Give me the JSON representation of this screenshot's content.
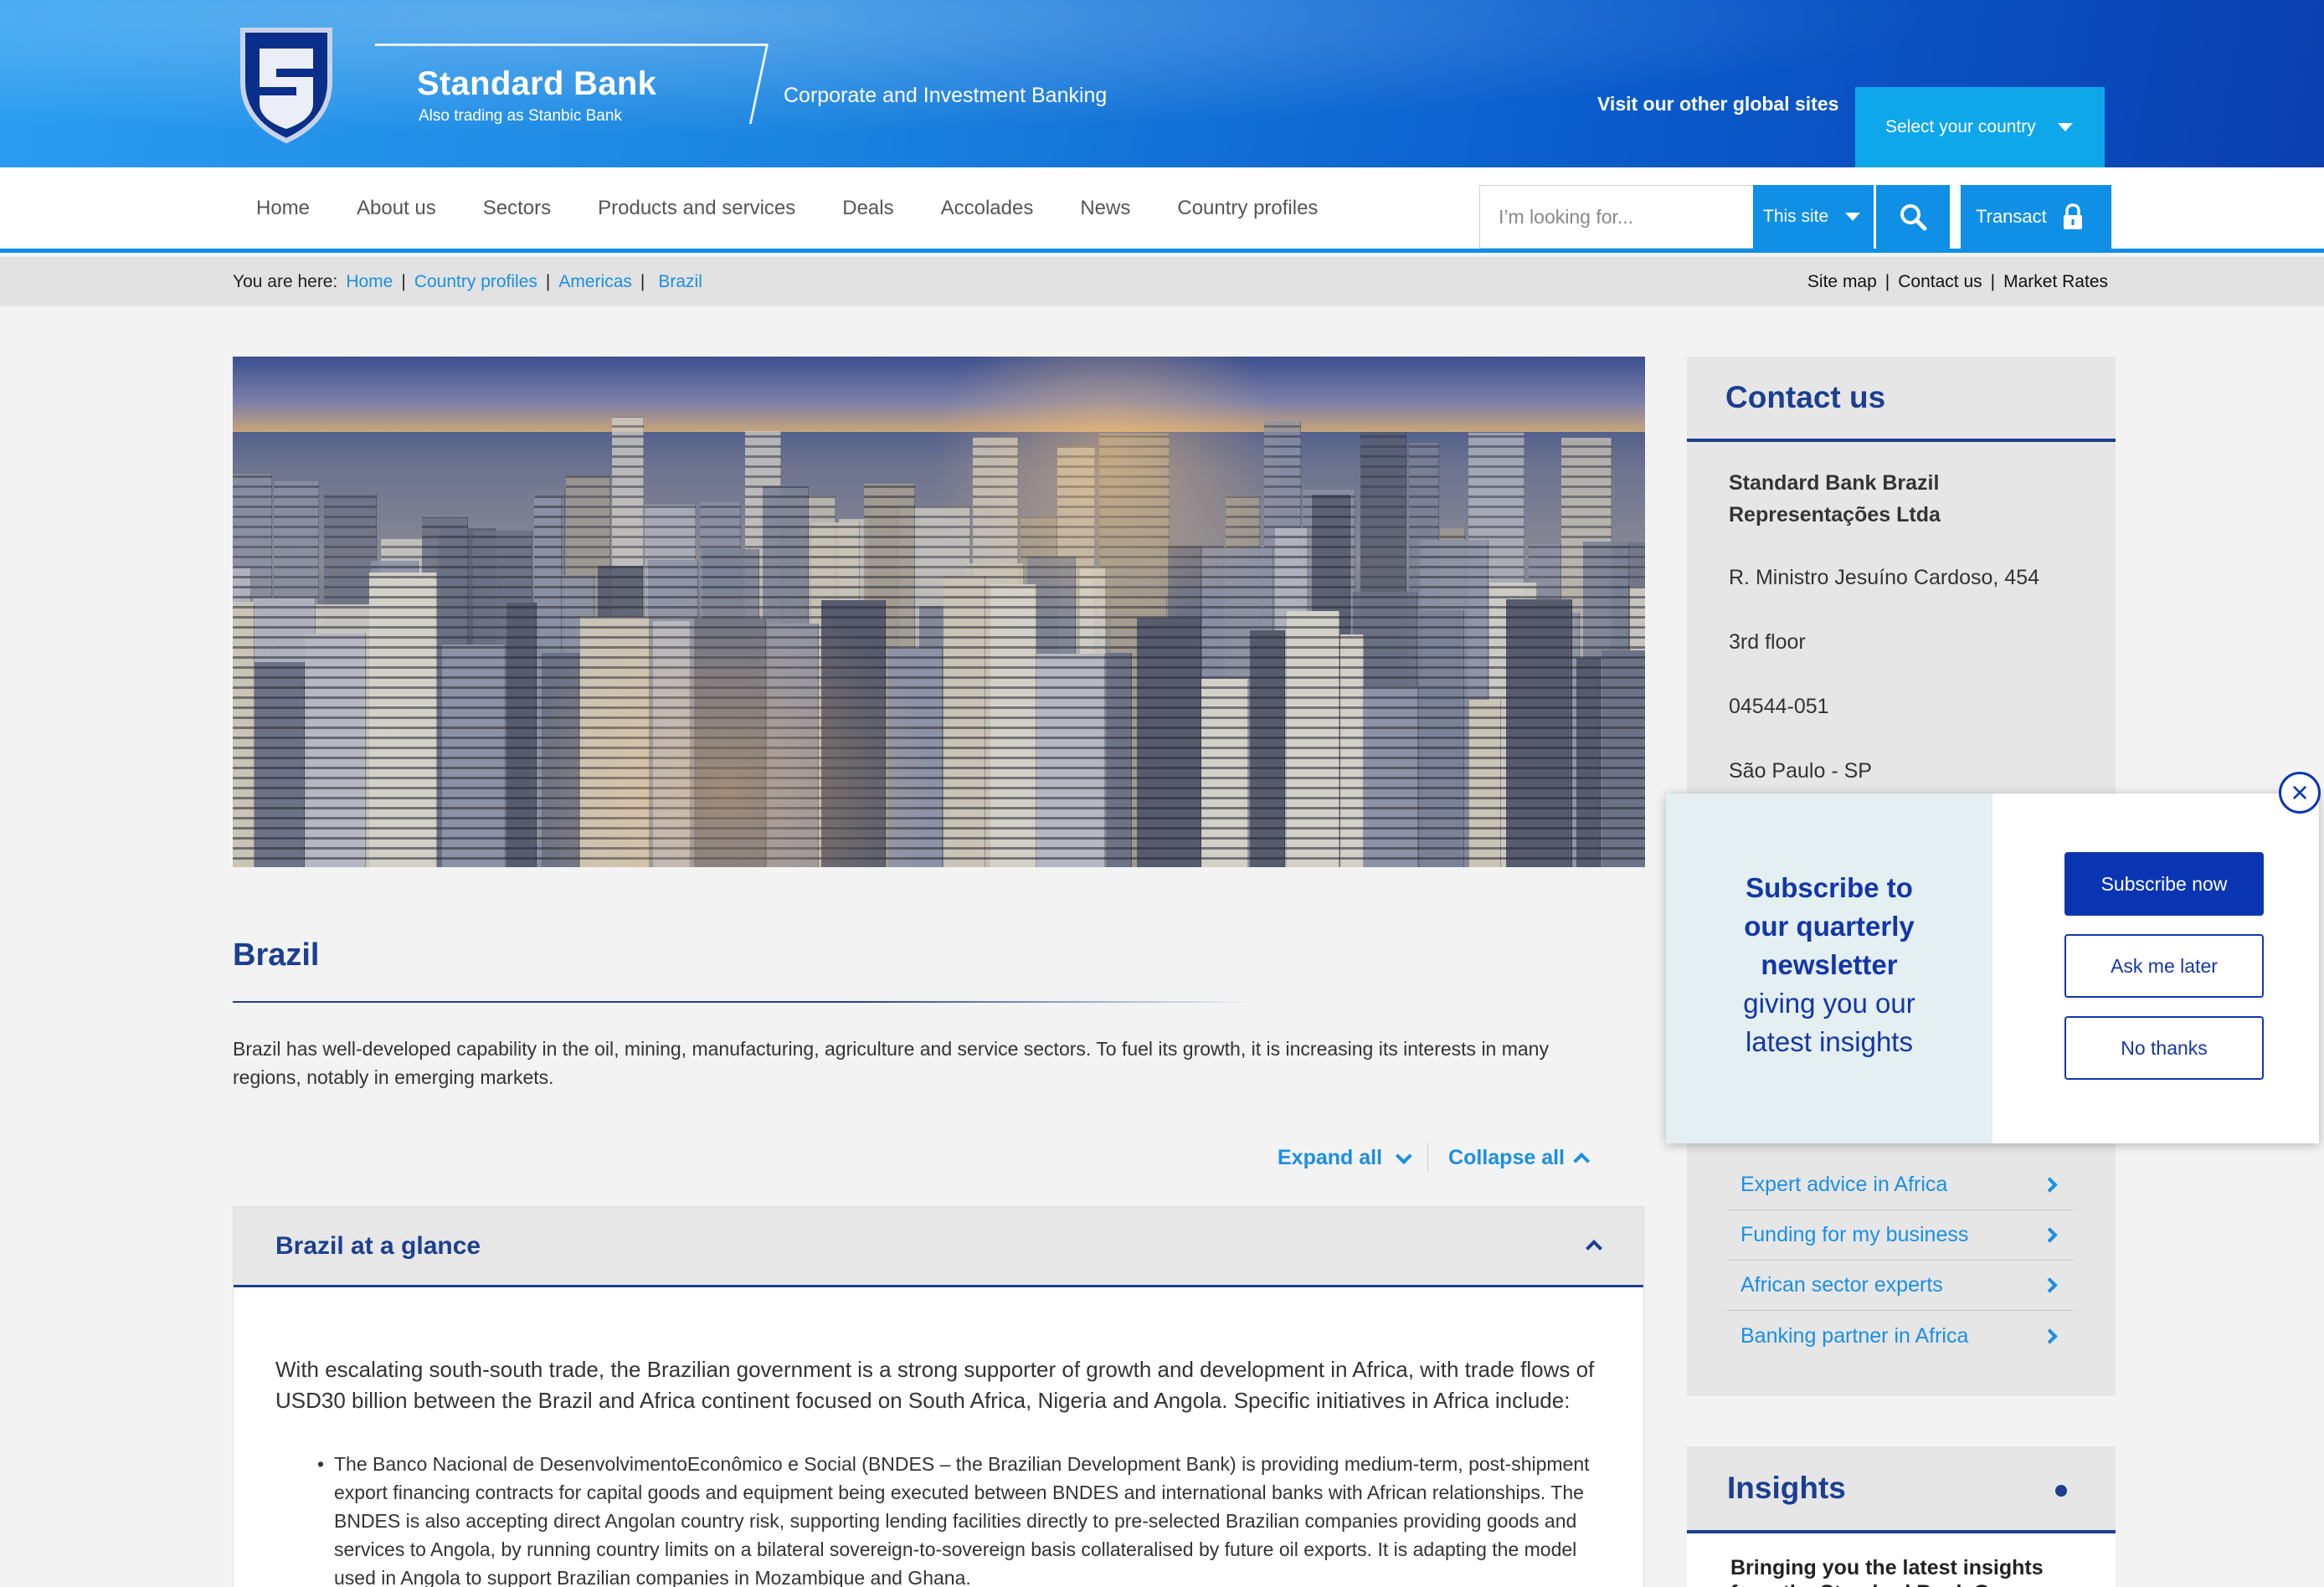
{
  "header": {
    "brand_name": "Standard Bank",
    "brand_sub": "Also trading as Stanbic Bank",
    "division": "Corporate and Investment Banking",
    "visit_label": "Visit our other global sites",
    "country_select": "Select your country"
  },
  "nav": {
    "items": [
      "Home",
      "About us",
      "Sectors",
      "Products and services",
      "Deals",
      "Accolades",
      "News",
      "Country profiles"
    ],
    "search_placeholder": "I’m looking for...",
    "scope": "This site",
    "transact": "Transact"
  },
  "breadcrumb": {
    "prefix": "You are here:",
    "items": [
      "Home",
      "Country profiles",
      "Americas",
      "Brazil"
    ],
    "utility": [
      "Site map",
      "Contact us",
      "Market Rates"
    ]
  },
  "main": {
    "title": "Brazil",
    "intro": "Brazil has well-developed capability in the oil, mining, manufacturing, agriculture and service sectors. To fuel its growth, it is increasing its interests in many regions, notably in emerging markets.",
    "expand_all": "Expand all",
    "collapse_all": "Collapse all",
    "accordion": {
      "title": "Brazil at a glance",
      "paragraph": "With escalating south-south trade, the Brazilian government is a strong supporter of growth and development in Africa, with trade flows of USD30 billion between the Brazil and Africa continent focused on South Africa, Nigeria and Angola. Specific initiatives in Africa include:",
      "bullet": "The Banco Nacional de DesenvolvimentoEconômico e Social (BNDES – the Brazilian Development Bank) is providing medium-term, post-shipment export financing contracts for capital goods and equipment being executed between BNDES and international banks with African relationships. The BNDES is also accepting direct Angolan country risk, supporting lending facilities directly to pre-selected Brazilian companies providing goods and services to Angola, by running country limits on a bilateral sovereign-to-sovereign basis collateralised by future oil exports. It is adapting the model used in Angola to support Brazilian companies in Mozambique and Ghana."
    }
  },
  "sidebar": {
    "contact_title": "Contact us",
    "contact_name_1": "Standard Bank Brazil",
    "contact_name_2": "Representações Ltda",
    "address": [
      "R. Ministro Jesuíno Cardoso, 454",
      "3rd floor",
      "04544-051",
      "São Paulo - SP"
    ],
    "links": [
      "Expert advice in Africa",
      "Funding for my business",
      "African sector experts",
      "Banking partner in Africa"
    ],
    "insights_title": "Insights",
    "insights_sub": "Bringing you the latest insights from the Standard Bank Group"
  },
  "popup": {
    "msg_bold_1": "Subscribe to",
    "msg_bold_2": "our quarterly",
    "msg_bold_3": "newsletter",
    "msg_1": "giving you our",
    "msg_2": "latest insights",
    "subscribe": "Subscribe now",
    "later": "Ask me later",
    "no": "No thanks",
    "close": "×"
  },
  "colors": {
    "brand_blue": "#1c3f8f",
    "link_blue": "#1a8fe3",
    "accent_blue": "#0f8fe6",
    "popup_blue": "#0a35b2"
  }
}
